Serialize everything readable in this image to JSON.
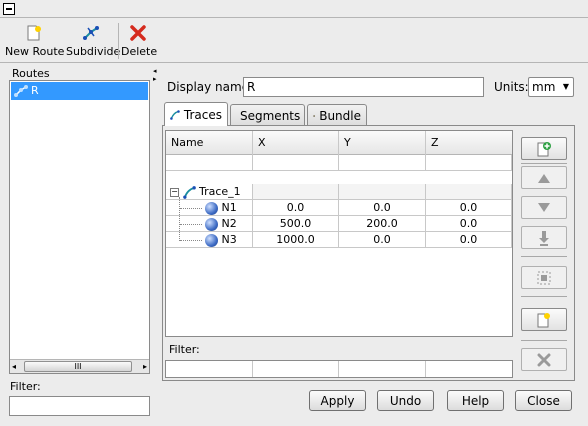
{
  "toolbar": {
    "new_route": "New Route",
    "subdivide": "Subdivide",
    "delete": "Delete"
  },
  "routes_panel": {
    "title": "Routes",
    "items": [
      "R"
    ],
    "filter_label": "Filter:",
    "filter_value": ""
  },
  "form": {
    "display_name_label": "Display name:",
    "display_name_value": "R",
    "units_label": "Units:",
    "units_value": "mm"
  },
  "tabs": [
    "Traces",
    "Segments",
    "Bundle"
  ],
  "table": {
    "columns": [
      "Name",
      "X",
      "Y",
      "Z"
    ],
    "trace_name": "Trace_1",
    "rows": [
      {
        "name": "N1",
        "x": "0.0",
        "y": "0.0",
        "z": "0.0"
      },
      {
        "name": "N2",
        "x": "500.0",
        "y": "200.0",
        "z": "0.0"
      },
      {
        "name": "N3",
        "x": "1000.0",
        "y": "0.0",
        "z": "0.0"
      }
    ],
    "filter_label": "Filter:"
  },
  "scroll_grip": "III",
  "buttons": {
    "apply": "Apply",
    "undo": "Undo",
    "help": "Help",
    "close": "Close"
  },
  "colors": {
    "selection": "#3399ff",
    "delete_red": "#d52b1e",
    "window_bg": "#ececec"
  }
}
